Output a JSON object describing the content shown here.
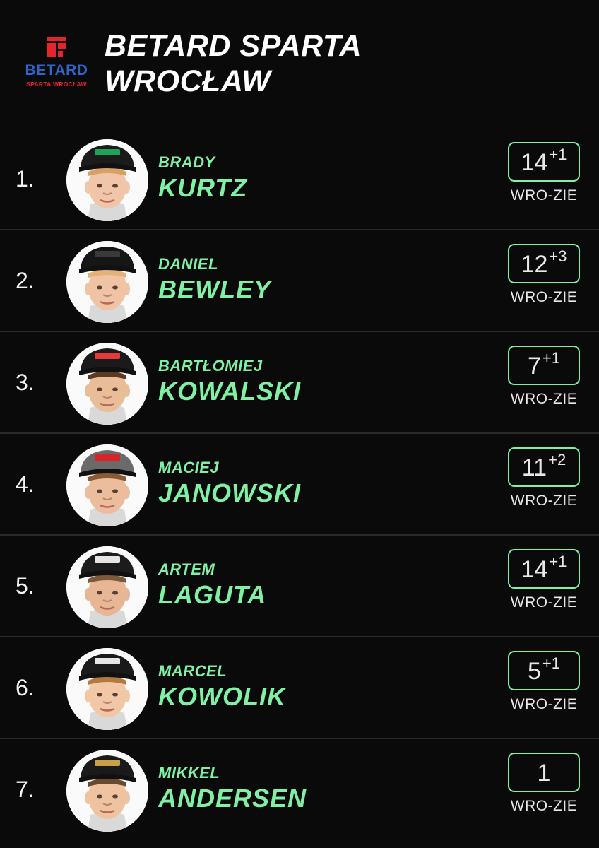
{
  "team": {
    "title_line1": "BETARD SPARTA",
    "title_line2": "WROCŁAW",
    "logo_brand": "BETARD",
    "logo_sub": "SPARTA WROCŁAW"
  },
  "colors": {
    "accent": "#7ff0a4",
    "background": "#0a0a0a",
    "logo_red": "#e8232b",
    "logo_blue": "#2f64c9"
  },
  "riders": [
    {
      "rank": "1.",
      "first": "BRADY",
      "last": "KURTZ",
      "points": "14",
      "bonus": "+1",
      "match": "WRO-ZIE",
      "helmet": "#1b1b1b",
      "helmet_accent": "#1fa35a",
      "skin": "#f1c6a8",
      "hair": "#d9a066"
    },
    {
      "rank": "2.",
      "first": "DANIEL",
      "last": "BEWLEY",
      "points": "12",
      "bonus": "+3",
      "match": "WRO-ZIE",
      "helmet": "#161616",
      "helmet_accent": "#3a3a3a",
      "skin": "#f0c3a4",
      "hair": "#e2b27a"
    },
    {
      "rank": "3.",
      "first": "BARTŁOMIEJ",
      "last": "KOWALSKI",
      "points": "7",
      "bonus": "+1",
      "match": "WRO-ZIE",
      "helmet": "#1a1a1a",
      "helmet_accent": "#e43a3a",
      "skin": "#e9bd98",
      "hair": "#5a3a24"
    },
    {
      "rank": "4.",
      "first": "MACIEJ",
      "last": "JANOWSKI",
      "points": "11",
      "bonus": "+2",
      "match": "WRO-ZIE",
      "helmet": "#6a6a6a",
      "helmet_accent": "#d8232a",
      "skin": "#ecbd9c",
      "hair": "#8a5a36"
    },
    {
      "rank": "5.",
      "first": "ARTEM",
      "last": "LAGUTA",
      "points": "14",
      "bonus": "+1",
      "match": "WRO-ZIE",
      "helmet": "#1c1c1c",
      "helmet_accent": "#e5e5e5",
      "skin": "#e6b695",
      "hair": "#7a5a3a"
    },
    {
      "rank": "6.",
      "first": "MARCEL",
      "last": "KOWOLIK",
      "points": "5",
      "bonus": "+1",
      "match": "WRO-ZIE",
      "helmet": "#1a1a1a",
      "helmet_accent": "#e5e5e5",
      "skin": "#f2c7a6",
      "hair": "#b07a40"
    },
    {
      "rank": "7.",
      "first": "MIKKEL",
      "last": "ANDERSEN",
      "points": "1",
      "bonus": "",
      "match": "WRO-ZIE",
      "helmet": "#1a1a1a",
      "helmet_accent": "#c9a04a",
      "skin": "#efc2a0",
      "hair": "#6a4a2e"
    }
  ]
}
